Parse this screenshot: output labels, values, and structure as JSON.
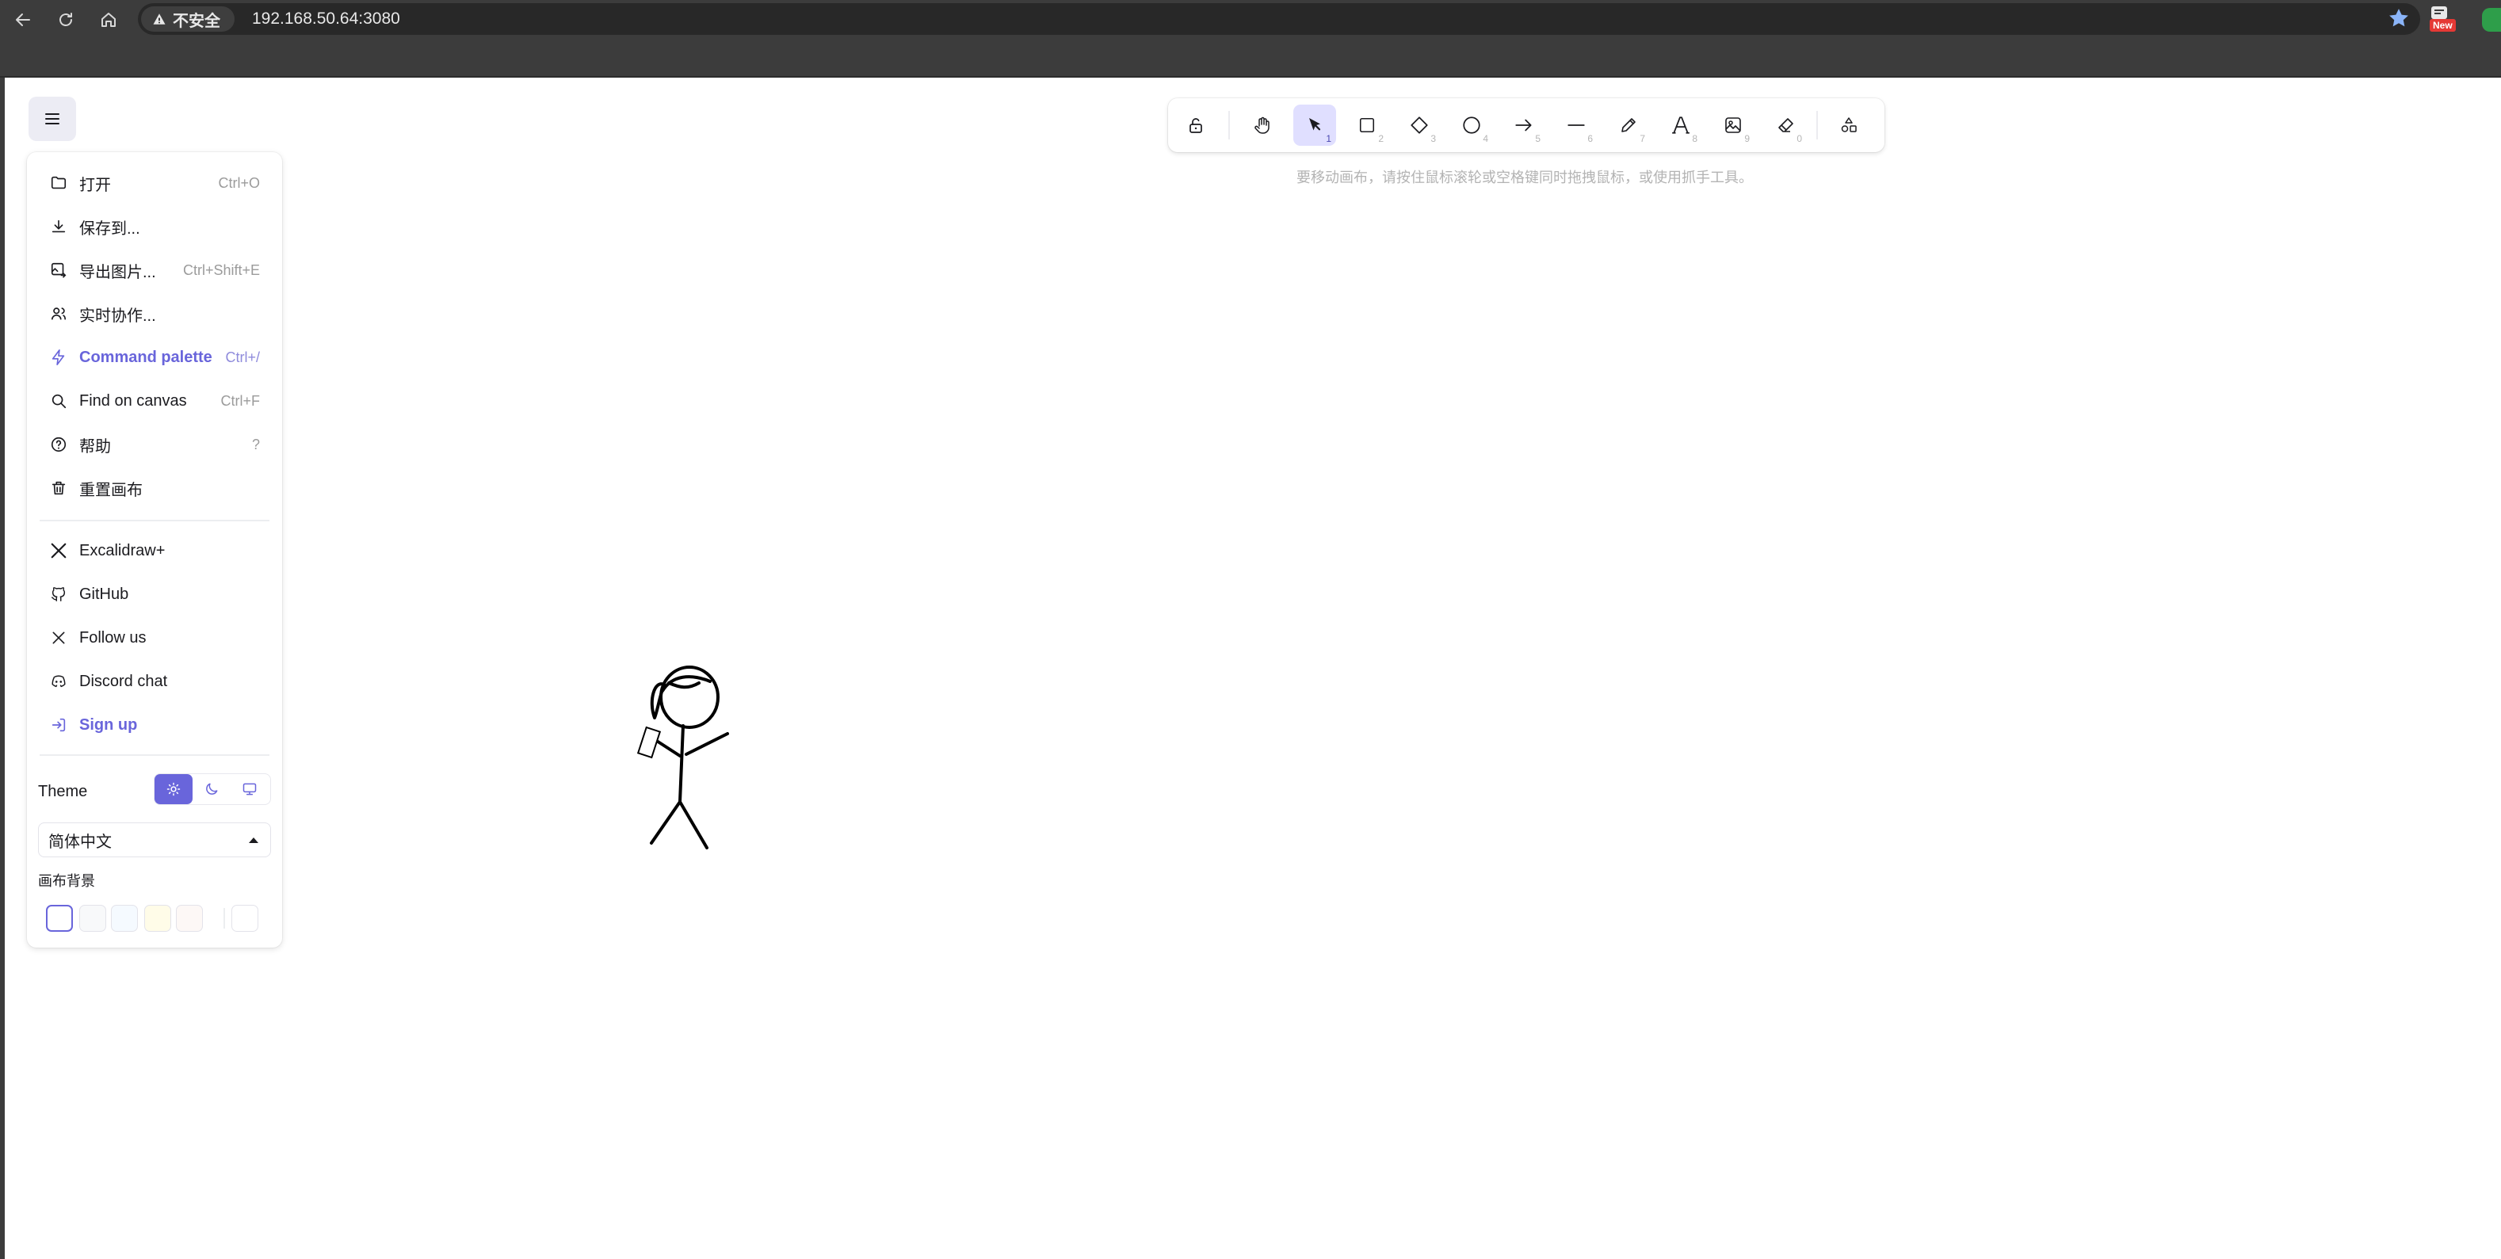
{
  "browser": {
    "security_label": "不安全",
    "url": "192.168.50.64:3080",
    "extension_badge": "New"
  },
  "menu": {
    "items": [
      {
        "label": "打开",
        "shortcut": "Ctrl+O"
      },
      {
        "label": "保存到...",
        "shortcut": ""
      },
      {
        "label": "导出图片...",
        "shortcut": "Ctrl+Shift+E"
      },
      {
        "label": "实时协作...",
        "shortcut": ""
      },
      {
        "label": "Command palette",
        "shortcut": "Ctrl+/"
      },
      {
        "label": "Find on canvas",
        "shortcut": "Ctrl+F"
      },
      {
        "label": "帮助",
        "shortcut": "?"
      },
      {
        "label": "重置画布",
        "shortcut": ""
      }
    ],
    "links": [
      {
        "label": "Excalidraw+"
      },
      {
        "label": "GitHub"
      },
      {
        "label": "Follow us"
      },
      {
        "label": "Discord chat"
      },
      {
        "label": "Sign up"
      }
    ],
    "theme_label": "Theme",
    "language": "简体中文",
    "canvas_bg_label": "画布背景",
    "bg_colors": [
      "#ffffff",
      "#f8f9fa",
      "#f5faff",
      "#fffce8",
      "#fdf8f6"
    ],
    "bg_custom": "#ffffff",
    "accent_color": "#6965db"
  },
  "toolbar": {
    "keys": [
      "1",
      "2",
      "3",
      "4",
      "5",
      "6",
      "7",
      "8",
      "9",
      "0"
    ],
    "active_tool": "selection"
  },
  "hint": "要移动画布，请按住鼠标滚轮或空格键同时拖拽鼠标，或使用抓手工具。"
}
